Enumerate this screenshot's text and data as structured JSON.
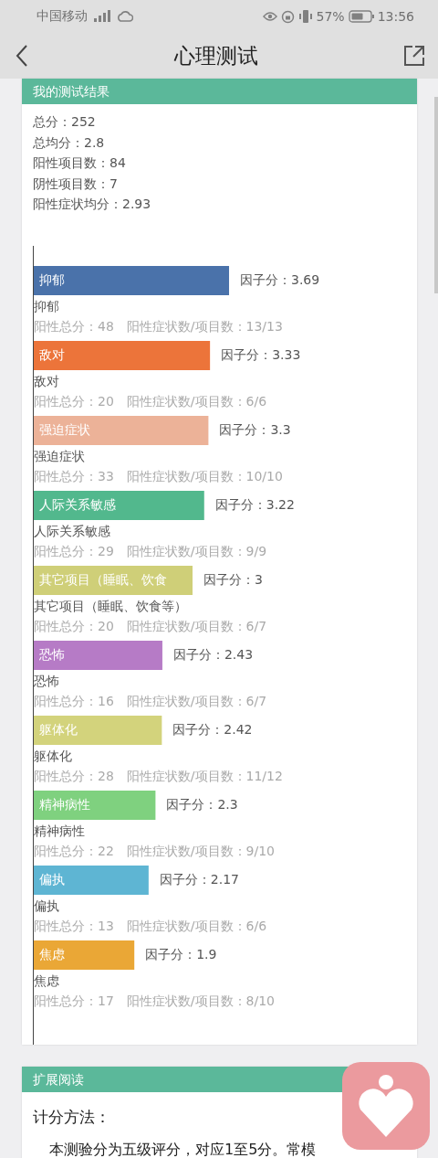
{
  "status_bar": {
    "carrier": "中国移动",
    "battery_percent": "57%",
    "time": "13:56"
  },
  "nav": {
    "title": "心理测试"
  },
  "result_card": {
    "title": "我的测试结果",
    "summary": [
      "总分：252",
      "总均分：2.8",
      "阳性项目数：84",
      "阴性项目数：7",
      "阳性症状均分：2.93"
    ],
    "chart_data": {
      "type": "bar",
      "orientation": "horizontal",
      "categories": [
        "抑郁",
        "敌对",
        "强迫症状",
        "人际关系敏感",
        "其它项目（睡眠、饮食",
        "恐怖",
        "躯体化",
        "精神病性",
        "偏执",
        "焦虑"
      ],
      "values": [
        3.69,
        3.33,
        3.3,
        3.22,
        3,
        2.43,
        2.42,
        2.3,
        2.17,
        1.9
      ],
      "value_labels": [
        "因子分：3.69",
        "因子分：3.33",
        "因子分：3.3",
        "因子分：3.22",
        "因子分：3",
        "因子分：2.43",
        "因子分：2.42",
        "因子分：2.3",
        "因子分：2.17",
        "因子分：1.9"
      ]
    },
    "factors": [
      {
        "name": "抑郁",
        "stats": "阳性总分：48　阳性症状数/项目数：13/13",
        "color": "#4a72aa"
      },
      {
        "name": "敌对",
        "stats": "阳性总分：20　阳性症状数/项目数：6/6",
        "color": "#ec743a"
      },
      {
        "name": "强迫症状",
        "stats": "阳性总分：33　阳性症状数/项目数：10/10",
        "color": "#ecb298"
      },
      {
        "name": "人际关系敏感",
        "stats": "阳性总分：29　阳性症状数/项目数：9/9",
        "color": "#52b88d"
      },
      {
        "name": "其它项目（睡眠、饮食等）",
        "stats": "阳性总分：20　阳性症状数/项目数：6/7",
        "color": "#cfcf78"
      },
      {
        "name": "恐怖",
        "stats": "阳性总分：16　阳性症状数/项目数：6/7",
        "color": "#b67bc6"
      },
      {
        "name": "躯体化",
        "stats": "阳性总分：28　阳性症状数/项目数：11/12",
        "color": "#d3d37c"
      },
      {
        "name": "精神病性",
        "stats": "阳性总分：22　阳性症状数/项目数：9/10",
        "color": "#7fd17f"
      },
      {
        "name": "偏执",
        "stats": "阳性总分：13　阳性症状数/项目数：6/6",
        "color": "#5eb5d3"
      },
      {
        "name": "焦虑",
        "stats": "阳性总分：17　阳性症状数/项目数：8/10",
        "color": "#eaa736"
      }
    ]
  },
  "reading_card": {
    "title": "扩展阅读",
    "heading": "计分方法：",
    "paragraph": "本测验分为五级评分，对应1至5分。常模"
  }
}
